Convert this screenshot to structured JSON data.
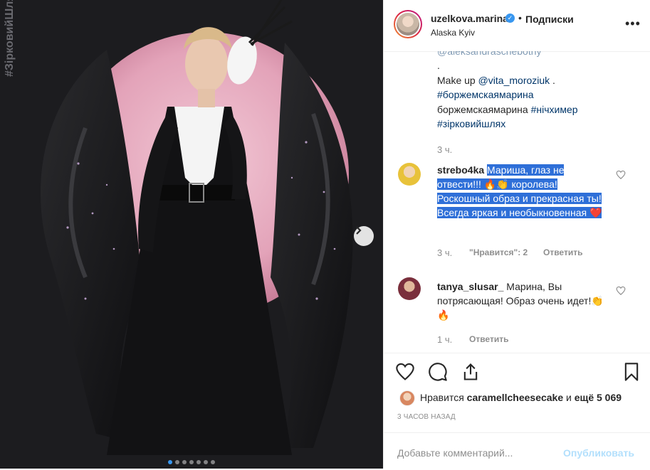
{
  "photo": {
    "wall_text": "#ЗірковийШлях",
    "dots": 7,
    "active_dot": 0
  },
  "header": {
    "username": "uzelkova.marina",
    "bullet": "•",
    "follow_label": "Подписки",
    "location": "Alaska Kyiv"
  },
  "caption": {
    "lines": [
      "@aleksandraschebotny",
      ".",
      "Make up @vita_moroziuk .",
      "#боржемскаямарина",
      "боржемскаямарина #нічхимер",
      "#зірковийшлях"
    ],
    "time": "3 ч."
  },
  "comments": [
    {
      "user": "strebo4ka",
      "text": "Мариша, глаз не отвести!!! 🔥👏 королева! Роскошный образ и прекрасная ты! Всегда яркая и необыкновенная ❤️",
      "time": "3 ч.",
      "likes": "\"Нравится\": 2",
      "reply": "Ответить"
    },
    {
      "user": "tanya_slusar_",
      "text": "Марина, Вы потрясающая! Образ очень идет!👏🔥",
      "time": "1 ч.",
      "reply": "Ответить"
    }
  ],
  "likes": {
    "prefix": "Нравится",
    "user": "caramellcheesecake",
    "mid": "и",
    "others": "ещё 5 069"
  },
  "timestamp": "3 ЧАСОВ НАЗАД",
  "add_comment": {
    "placeholder": "Добавьте комментарий...",
    "post_label": "Опубликовать"
  },
  "colors": {
    "link": "#003569",
    "verified": "#3897f0",
    "highlight": "#2e6fd8"
  }
}
